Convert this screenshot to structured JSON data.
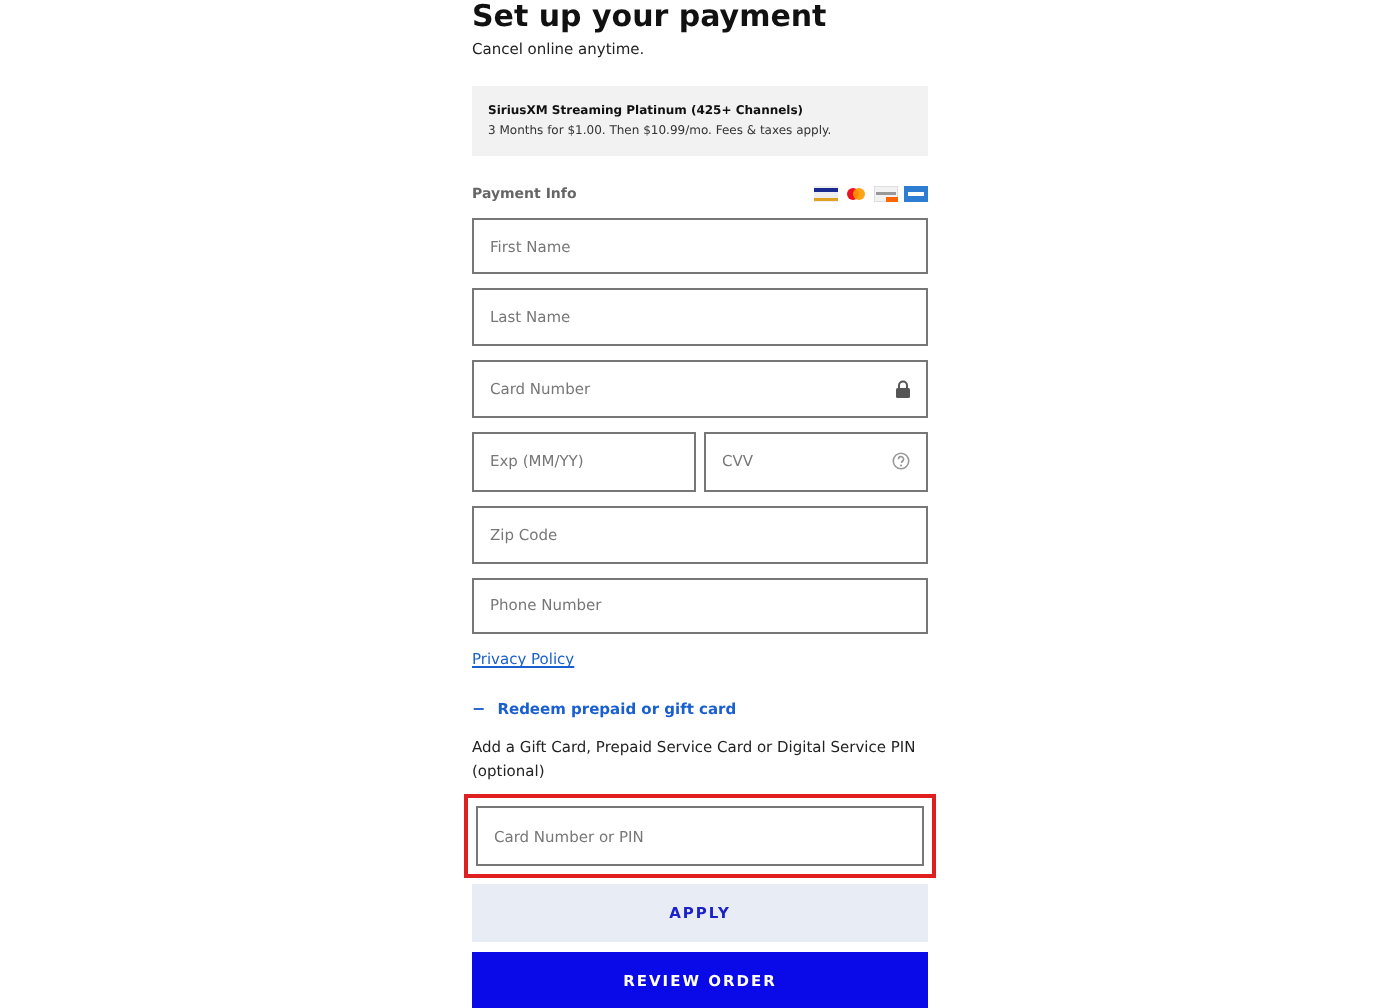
{
  "title": "Set up your payment",
  "subtitle": "Cancel online anytime.",
  "plan": {
    "name": "SiriusXM Streaming Platinum (425+ Channels)",
    "offer": "3 Months for $1.00. Then $10.99/mo. Fees & taxes apply."
  },
  "payment_info": {
    "label": "Payment Info",
    "fields": [
      {
        "kind": "full",
        "placeholder": "First Name"
      },
      {
        "kind": "full",
        "placeholder": "Last Name"
      },
      {
        "kind": "lock",
        "placeholder": "Card Number"
      },
      {
        "kind": "pair",
        "placeholder": "Exp (MM/YY)",
        "second_placeholder": "CVV"
      },
      {
        "kind": "full",
        "placeholder": "Zip Code"
      },
      {
        "kind": "full",
        "placeholder": "Phone Number"
      }
    ]
  },
  "privacy_link": "Privacy Policy",
  "redeem": {
    "toggle": "−",
    "label": "Redeem prepaid or gift card",
    "expanded": true,
    "hint": "Add a Gift Card, Prepaid Service Card or Digital Service PIN (optional)",
    "field": {
      "placeholder": "Card Number or PIN",
      "highlighted": true
    },
    "button": "APPLY"
  },
  "submit": "REVIEW ORDER"
}
